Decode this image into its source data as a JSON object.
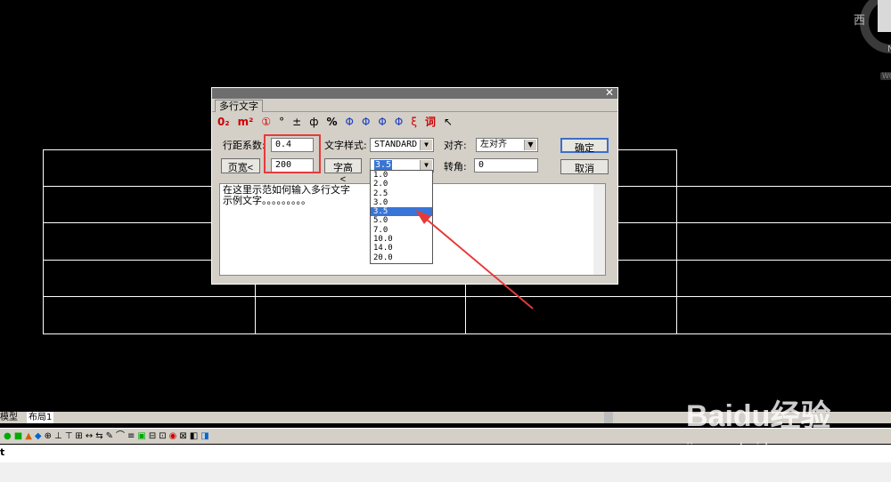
{
  "viewcube": {
    "direction_west": "西",
    "direction_north": "N",
    "wcs_label": "WCS"
  },
  "dialog": {
    "title": "",
    "tab_label": "多行文字",
    "symbols": [
      "0₂",
      "m²",
      "①",
      "°",
      "±",
      "ф",
      "%",
      "Φ",
      "Φ",
      "Φ",
      "Φ",
      "ξ",
      "词",
      "↖"
    ],
    "line_spacing_label": "行距系数:",
    "line_spacing_value": "0.4",
    "page_width_button": "页宽<",
    "page_width_value": "200",
    "text_style_label": "文字样式:",
    "text_style_value": "STANDARD",
    "char_height_button": "字高<",
    "char_height_value": "3.5",
    "align_label": "对齐:",
    "align_value": "左对齐",
    "rotation_label": "转角:",
    "rotation_value": "0",
    "ok_button": "确定",
    "cancel_button": "取消",
    "editor_text": "在这里示范如何输入多行文字\n示例文字。。。。。。。。。",
    "height_options": [
      "1.0",
      "2.0",
      "2.5",
      "3.0",
      "3.5",
      "5.0",
      "7.0",
      "10.0",
      "14.0",
      "20.0"
    ],
    "height_selected_index": 4,
    "colors": {
      "accent": "#3875d7",
      "annotation": "#e63a3a",
      "symbol_red": "#cc0000",
      "symbol_blue": "#1f3fbf"
    }
  },
  "layout_tabs": {
    "model": "模型",
    "layout1": "布局1"
  },
  "command_line": {
    "prompt": "t"
  },
  "watermark": {
    "brand": "Baidu经验",
    "url": "jingyan.baidu.com"
  }
}
